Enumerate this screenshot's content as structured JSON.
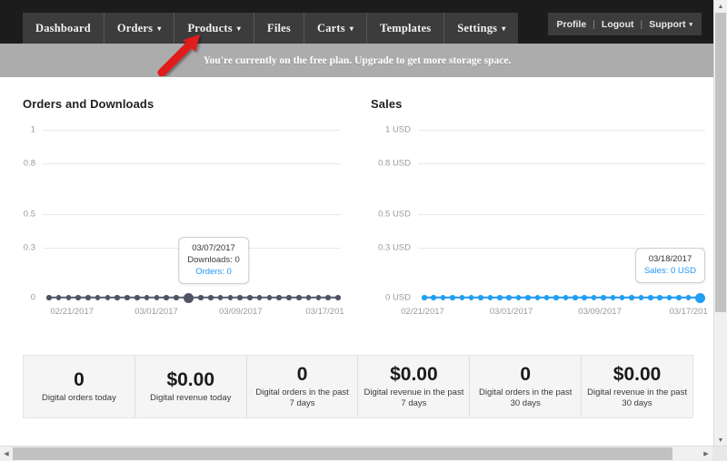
{
  "header": {
    "nav_items": [
      {
        "label": "Dashboard",
        "caret": false
      },
      {
        "label": "Orders",
        "caret": true
      },
      {
        "label": "Products",
        "caret": true
      },
      {
        "label": "Files",
        "caret": false
      },
      {
        "label": "Carts",
        "caret": true
      },
      {
        "label": "Templates",
        "caret": false
      },
      {
        "label": "Settings",
        "caret": true
      }
    ],
    "account": {
      "profile": "Profile",
      "logout": "Logout",
      "support": "Support",
      "separator": "|",
      "caret": "▾"
    },
    "bg_color": "#1c1c1c",
    "item_color": "#3c3c3c"
  },
  "notice": {
    "text": "You're currently on the free plan. Upgrade to get more storage space.",
    "bg_color": "#acacac",
    "text_color": "#ffffff"
  },
  "annotation": {
    "arrow_color": "#e01b1b",
    "points_to": "Products"
  },
  "chart_data": [
    {
      "type": "line",
      "title": "Orders and Downloads",
      "xlabel": "",
      "ylabel": "",
      "ylim": [
        0,
        1
      ],
      "yticks": [
        "1",
        "0.8",
        "0.5",
        "0.3",
        "0"
      ],
      "ytick_values": [
        1,
        0.8,
        0.5,
        0.3,
        0
      ],
      "xticks": [
        "02/21/2017",
        "03/01/2017",
        "03/09/2017",
        "03/17/201"
      ],
      "grid": true,
      "legend_position": "none",
      "point_count": 30,
      "highlight_index": 14,
      "series": [
        {
          "name": "Downloads",
          "color": "#4e5463",
          "values": [
            0,
            0,
            0,
            0,
            0,
            0,
            0,
            0,
            0,
            0,
            0,
            0,
            0,
            0,
            0,
            0,
            0,
            0,
            0,
            0,
            0,
            0,
            0,
            0,
            0,
            0,
            0,
            0,
            0,
            0
          ]
        },
        {
          "name": "Orders",
          "color": "#2196f3",
          "values": [
            0,
            0,
            0,
            0,
            0,
            0,
            0,
            0,
            0,
            0,
            0,
            0,
            0,
            0,
            0,
            0,
            0,
            0,
            0,
            0,
            0,
            0,
            0,
            0,
            0,
            0,
            0,
            0,
            0,
            0
          ]
        }
      ],
      "tooltip": {
        "date": "03/07/2017",
        "line1": "Downloads: 0",
        "line2": "Orders: 0"
      }
    },
    {
      "type": "line",
      "title": "Sales",
      "xlabel": "",
      "ylabel": "",
      "ylim": [
        0,
        1
      ],
      "yticks": [
        "1 USD",
        "0.8 USD",
        "0.5 USD",
        "0.3 USD",
        "0 USD"
      ],
      "ytick_values": [
        1,
        0.8,
        0.5,
        0.3,
        0
      ],
      "xticks": [
        "02/21/2017",
        "03/01/2017",
        "03/09/2017",
        "03/17/201"
      ],
      "grid": true,
      "legend_position": "none",
      "point_count": 30,
      "highlight_index": 29,
      "series": [
        {
          "name": "Sales",
          "color": "#1e9ff2",
          "values": [
            0,
            0,
            0,
            0,
            0,
            0,
            0,
            0,
            0,
            0,
            0,
            0,
            0,
            0,
            0,
            0,
            0,
            0,
            0,
            0,
            0,
            0,
            0,
            0,
            0,
            0,
            0,
            0,
            0,
            0
          ]
        }
      ],
      "tooltip": {
        "date": "03/18/2017",
        "line1": "Sales: 0 USD"
      }
    }
  ],
  "stats": [
    {
      "value": "0",
      "label": "Digital orders today"
    },
    {
      "value": "$0.00",
      "label": "Digital revenue today"
    },
    {
      "value": "0",
      "label": "Digital orders in the past 7 days"
    },
    {
      "value": "$0.00",
      "label": "Digital revenue in the past 7 days"
    },
    {
      "value": "0",
      "label": "Digital orders in the past 30 days"
    },
    {
      "value": "$0.00",
      "label": "Digital revenue in the past 30 days"
    }
  ],
  "scrollbars": {
    "vertical_up": "▲",
    "vertical_down": "▼",
    "horizontal_left": "◀",
    "horizontal_right": "▶"
  }
}
